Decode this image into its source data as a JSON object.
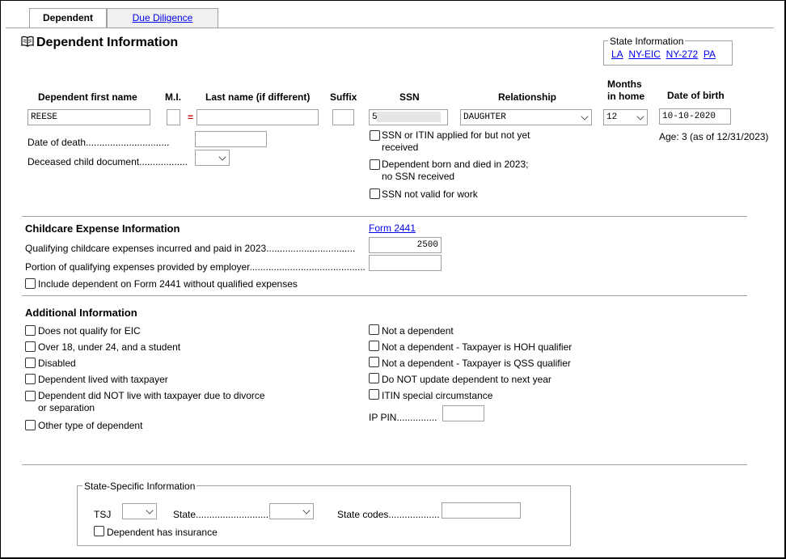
{
  "tabs": [
    {
      "label": "Dependent",
      "active": true
    },
    {
      "label": "Due Diligence",
      "active": false
    }
  ],
  "page_title": "Dependent Information",
  "state_info": {
    "legend": "State Information",
    "links": [
      "LA",
      "NY-EIC",
      "NY-272",
      "PA"
    ]
  },
  "headers": {
    "first_name": "Dependent first name",
    "mi": "M.I.",
    "last_name": "Last name (if different)",
    "suffix": "Suffix",
    "ssn": "SSN",
    "relationship": "Relationship",
    "months_line1": "Months",
    "months_line2": "in home",
    "dob": "Date of birth"
  },
  "fields": {
    "first_name": "REESE",
    "mi": "",
    "last_name_marker": "=",
    "last_name": "",
    "suffix": "",
    "ssn": "5",
    "relationship": "DAUGHTER",
    "months": "12",
    "dob": "10-10-2020",
    "age_note": "Age: 3 (as of 12/31/2023)"
  },
  "death": {
    "date_label": "Date of death...............................",
    "doc_label": "Deceased child document.................."
  },
  "ssn_checks": [
    {
      "line1": "SSN or ITIN applied for but not yet",
      "line2": "received",
      "checked": false
    },
    {
      "line1": "Dependent born and died in 2023;",
      "line2": "no SSN received",
      "checked": false
    },
    {
      "line1": "SSN not valid for work",
      "line2": "",
      "checked": false
    }
  ],
  "childcare": {
    "title": "Childcare Expense Information",
    "form_link": "Form 2441",
    "expenses_label": "Qualifying childcare expenses incurred and paid in 2023.................................",
    "expenses_value": "2500",
    "employer_label": "Portion of qualifying expenses provided by employer...........................................",
    "employer_value": "",
    "include_label": "Include dependent on Form 2441 without qualified expenses"
  },
  "additional": {
    "title": "Additional Information",
    "left": [
      {
        "line1": "Does not qualify for EIC",
        "line2": ""
      },
      {
        "line1": "Over 18, under 24, and a student",
        "line2": ""
      },
      {
        "line1": "Disabled",
        "line2": ""
      },
      {
        "line1": "Dependent lived with taxpayer",
        "line2": ""
      },
      {
        "line1": "Dependent did NOT live with taxpayer due to divorce",
        "line2": "or separation"
      },
      {
        "line1": "Other type of dependent",
        "line2": ""
      }
    ],
    "right": [
      {
        "line1": "Not a dependent"
      },
      {
        "line1": "Not a dependent - Taxpayer is HOH qualifier"
      },
      {
        "line1": "Not a dependent - Taxpayer is QSS qualifier"
      },
      {
        "line1": "Do NOT update dependent to next year"
      },
      {
        "line1": "ITIN special circumstance"
      }
    ],
    "ip_pin_label": "IP PIN...............",
    "ip_pin_value": ""
  },
  "state_specific": {
    "legend": "State-Specific Information",
    "tsj_label": "TSJ",
    "state_label": "State...........................",
    "state_codes_label": "State codes...................",
    "insurance_label": "Dependent has insurance"
  },
  "colors": {
    "link": "#0000ee",
    "border": "#a0a0a0",
    "marker": "#cc0000"
  }
}
